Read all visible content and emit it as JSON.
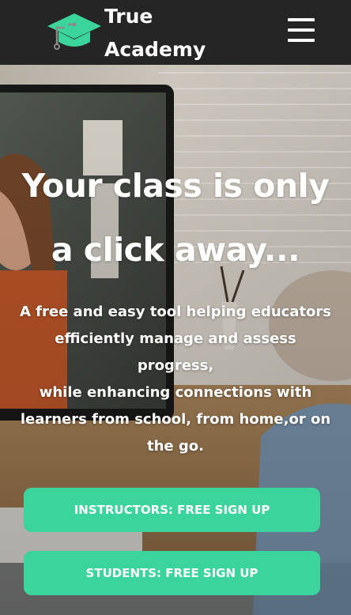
{
  "navbar": {
    "brand_line1": "True",
    "brand_line2": "Academy",
    "logo_icon": "graduation-cap-circuit-icon",
    "menu_icon": "hamburger-menu-icon"
  },
  "hero": {
    "headline_line1": "Your class is only",
    "headline_line2": "a click away...",
    "sub_lines": [
      "A free and easy tool helping educators",
      "efficiently manage and assess",
      "progress,",
      "while enhancing connections with",
      "learners from school, from home,or on",
      "the go."
    ],
    "cta_instructors": "INSTRUCTORS: FREE SIGN UP",
    "cta_students": "STUDENTS: FREE SIGN UP"
  },
  "colors": {
    "navbar_bg": "#252525",
    "accent": "#3bd49c",
    "text": "#ffffff"
  }
}
